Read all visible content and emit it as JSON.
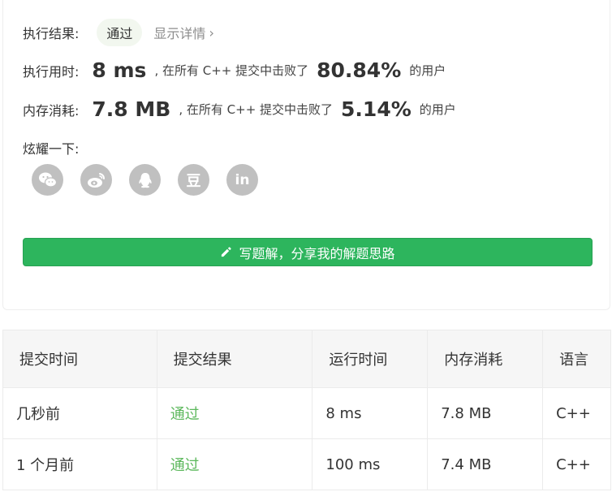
{
  "result": {
    "label": "执行结果:",
    "status": "通过",
    "details_link": "显示详情",
    "details_chevron": "›"
  },
  "runtime": {
    "label": "执行用时:",
    "value": "8 ms",
    "mid_text": ", 在所有 C++ 提交中击败了",
    "percent": "80.84%",
    "suffix": "的用户"
  },
  "memory": {
    "label": "内存消耗:",
    "value": "7.8 MB",
    "mid_text": ", 在所有 C++ 提交中击败了",
    "percent": "5.14%",
    "suffix": "的用户"
  },
  "share": {
    "label": "炫耀一下:",
    "icons": [
      "wechat-icon",
      "weibo-icon",
      "qq-icon",
      "douban-icon",
      "linkedin-icon"
    ],
    "douban_glyph": "豆",
    "linkedin_glyph": "in"
  },
  "solution_button": {
    "label": "写题解，分享我的解题思路",
    "icon": "pencil-icon"
  },
  "submissions": {
    "headers": [
      "提交时间",
      "提交结果",
      "运行时间",
      "内存消耗",
      "语言"
    ],
    "rows": [
      {
        "time": "几秒前",
        "result": "通过",
        "runtime": "8 ms",
        "memory": "7.8 MB",
        "language": "C++"
      },
      {
        "time": "1 个月前",
        "result": "通过",
        "runtime": "100 ms",
        "memory": "7.4 MB",
        "language": "C++"
      }
    ]
  },
  "colors": {
    "accent_green": "#2db55d",
    "result_green": "#5cb85c",
    "icon_gray": "#c0c0c0"
  }
}
